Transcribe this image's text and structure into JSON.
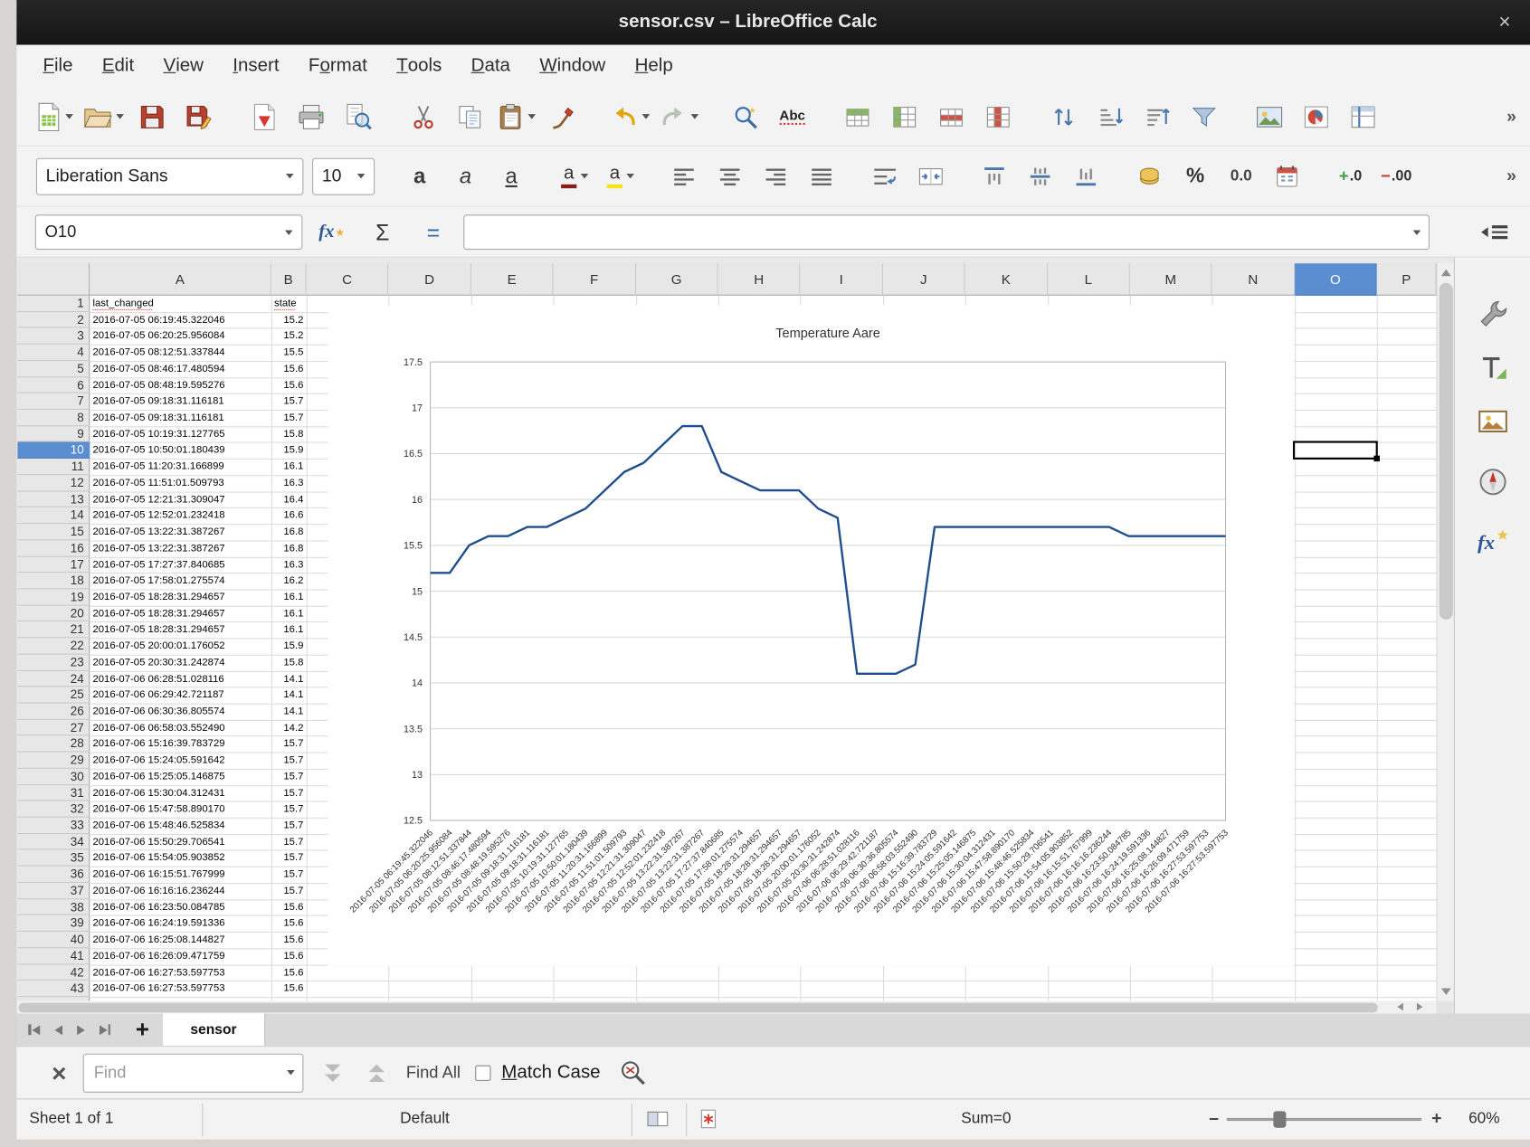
{
  "window": {
    "title": "sensor.csv – LibreOffice Calc",
    "close_glyph": "×"
  },
  "menubar": {
    "items": [
      {
        "label": "File",
        "mnemonic_index": 0
      },
      {
        "label": "Edit",
        "mnemonic_index": 0
      },
      {
        "label": "View",
        "mnemonic_index": 0
      },
      {
        "label": "Insert",
        "mnemonic_index": 0
      },
      {
        "label": "Format",
        "mnemonic_index": 1
      },
      {
        "label": "Tools",
        "mnemonic_index": 0
      },
      {
        "label": "Data",
        "mnemonic_index": 0
      },
      {
        "label": "Window",
        "mnemonic_index": 0
      },
      {
        "label": "Help",
        "mnemonic_index": 0
      }
    ]
  },
  "toolbars": {
    "overflow_glyph": "»",
    "spelling_label": "Abc",
    "font_name": "Liberation Sans",
    "font_size": "10",
    "bold_glyph": "a",
    "italic_glyph": "a",
    "underline_glyph": "a",
    "font_color_glyph": "a",
    "highlight_glyph": "a",
    "percent_label": "%",
    "number_format_label": "0.0",
    "add_decimal_plus": "+",
    "add_decimal_label": ".0",
    "del_decimal_minus": "−",
    "del_decimal_label": ".00",
    "standard_icons": [
      "new-document",
      "open",
      "save",
      "save-as",
      "export-pdf",
      "print",
      "print-preview",
      "cut",
      "copy",
      "paste",
      "clone-formatting",
      "undo",
      "redo",
      "find-and-replace",
      "spelling",
      "insert-row",
      "insert-column",
      "delete-row",
      "delete-column",
      "sort",
      "sort-ascending",
      "sort-descending",
      "autofilter",
      "insert-image",
      "insert-chart",
      "freeze-panes"
    ],
    "formatting_icons": [
      "font-name",
      "font-size",
      "bold",
      "italic",
      "underline",
      "font-color",
      "highlighting",
      "align-left",
      "align-center",
      "align-right",
      "justify",
      "wrap-text",
      "merge-cells",
      "align-top",
      "center-vertically",
      "align-bottom",
      "currency",
      "percent",
      "number-format",
      "date",
      "add-decimal",
      "delete-decimal"
    ]
  },
  "formula_bar": {
    "cell_reference": "O10",
    "wizard_label": "fx",
    "sum_glyph": "Σ",
    "equals_glyph": "=",
    "input_value": ""
  },
  "sheet": {
    "columns": [
      "A",
      "B",
      "C",
      "D",
      "E",
      "F",
      "G",
      "H",
      "I",
      "J",
      "K",
      "L",
      "M",
      "N",
      "O",
      "P"
    ],
    "row_count": 43,
    "selected_column": "O",
    "selected_row": 10,
    "selected_cell": "O10",
    "header_row": {
      "A": "last_changed",
      "B": "state"
    }
  },
  "chart_data": {
    "type": "line",
    "title": "Temperature Aare",
    "xlabel": "",
    "ylabel": "",
    "ylim": [
      12.5,
      17.5
    ],
    "ytick_step": 0.5,
    "grid": true,
    "legend": false,
    "line_color": "#1f4e8c",
    "categories": [
      "2016-07-05 06:19:45.322046",
      "2016-07-05 06:20:25.956084",
      "2016-07-05 08:12:51.337844",
      "2016-07-05 08:46:17.480594",
      "2016-07-05 08:48:19.595276",
      "2016-07-05 09:18:31.116181",
      "2016-07-05 09:18:31.116181",
      "2016-07-05 10:19:31.127765",
      "2016-07-05 10:50:01.180439",
      "2016-07-05 11:20:31.166899",
      "2016-07-05 11:51:01.509793",
      "2016-07-05 12:21:31.309047",
      "2016-07-05 12:52:01.232418",
      "2016-07-05 13:22:31.387267",
      "2016-07-05 13:22:31.387267",
      "2016-07-05 17:27:37.840685",
      "2016-07-05 17:58:01.275574",
      "2016-07-05 18:28:31.294657",
      "2016-07-05 18:28:31.294657",
      "2016-07-05 18:28:31.294657",
      "2016-07-05 20:00:01.176052",
      "2016-07-05 20:30:31.242874",
      "2016-07-06 06:28:51.028116",
      "2016-07-06 06:29:42.721187",
      "2016-07-06 06:30:36.805574",
      "2016-07-06 06:58:03.552490",
      "2016-07-06 15:16:39.783729",
      "2016-07-06 15:24:05.591642",
      "2016-07-06 15:25:05.146875",
      "2016-07-06 15:30:04.312431",
      "2016-07-06 15:47:58.890170",
      "2016-07-06 15:48:46.525834",
      "2016-07-06 15:50:29.706541",
      "2016-07-06 15:54:05.903852",
      "2016-07-06 16:15:51.767999",
      "2016-07-06 16:16:16.236244",
      "2016-07-06 16:23:50.084785",
      "2016-07-06 16:24:19.591336",
      "2016-07-06 16:25:08.144827",
      "2016-07-06 16:26:09.471759",
      "2016-07-06 16:27:53.597753",
      "2016-07-06 16:27:53.597753"
    ],
    "values": [
      15.2,
      15.2,
      15.5,
      15.6,
      15.6,
      15.7,
      15.7,
      15.8,
      15.9,
      16.1,
      16.3,
      16.4,
      16.6,
      16.8,
      16.8,
      16.3,
      16.2,
      16.1,
      16.1,
      16.1,
      15.9,
      15.8,
      14.1,
      14.1,
      14.1,
      14.2,
      15.7,
      15.7,
      15.7,
      15.7,
      15.7,
      15.7,
      15.7,
      15.7,
      15.7,
      15.7,
      15.6,
      15.6,
      15.6,
      15.6,
      15.6,
      15.6
    ]
  },
  "tabbar": {
    "add_glyph": "+",
    "tabs": [
      "sensor"
    ],
    "active_tab": "sensor"
  },
  "findbar": {
    "close_glyph": "×",
    "placeholder": "Find",
    "find_all_label": "Find All",
    "match_case_label": "Match Case",
    "match_case_checked": false
  },
  "statusbar": {
    "sheet_info": "Sheet 1 of 1",
    "page_style": "Default",
    "sum_info": "Sum=0",
    "zoom_out_glyph": "–",
    "zoom_in_glyph": "+",
    "zoom_percent": "60%"
  },
  "sidebar": {
    "functions_label": "fx",
    "panels": [
      "sidebar-settings",
      "properties",
      "styles",
      "gallery",
      "navigator",
      "functions"
    ]
  },
  "colors": {
    "selection": "#5b8ed1",
    "chart_line": "#1f4e8c",
    "titlebar": "#1a1a1a"
  }
}
